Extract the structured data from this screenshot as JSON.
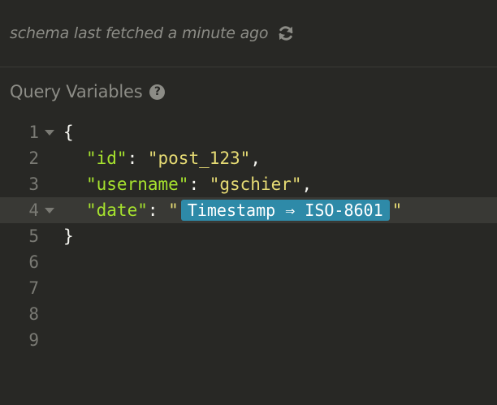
{
  "schema": {
    "status_text": "schema last fetched a minute ago",
    "refresh_icon": "refresh-icon"
  },
  "query_variables": {
    "title": "Query Variables",
    "help_icon": "question-circle-icon",
    "help_glyph": "?"
  },
  "editor": {
    "line_numbers": [
      "1",
      "2",
      "3",
      "4",
      "5",
      "6",
      "7",
      "8",
      "9"
    ],
    "active_line": 4,
    "colors": {
      "key": "#a6e22e",
      "string": "#e6db74",
      "punctuation": "#f5f5f0",
      "tag_background": "#2e8aa8"
    },
    "lines": {
      "l1": {
        "open": "{"
      },
      "l2": {
        "key": "\"id\"",
        "colon": ": ",
        "value": "\"post_123\"",
        "comma": ","
      },
      "l3": {
        "key": "\"username\"",
        "colon": ": ",
        "value": "\"gschier\"",
        "comma": ","
      },
      "l4": {
        "key": "\"date\"",
        "colon": ": ",
        "quote_open": "\"",
        "tag": "Timestamp ⇒ ISO-8601",
        "quote_close": "\""
      },
      "l5": {
        "close": "}"
      }
    }
  }
}
